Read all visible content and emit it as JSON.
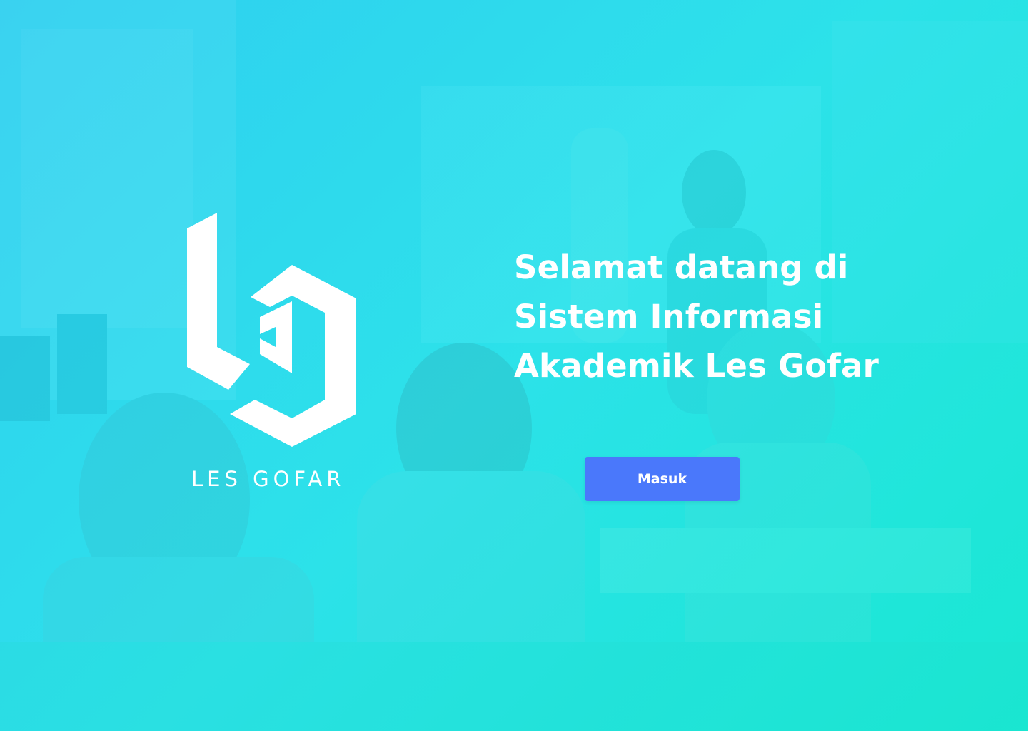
{
  "brand": {
    "name": "LES GOFAR",
    "logo_icon": "les-gofar-logo-icon"
  },
  "hero": {
    "welcome_text": "Selamat datang di Sistem Informasi Akademik Les Gofar",
    "background_image": "classroom-students-raising-hands",
    "login_label": "Masuk"
  },
  "colors": {
    "overlay_start": "#2fd0ef",
    "overlay_end": "#1ce8d2",
    "button_bg": "#4a78fb",
    "text": "#ffffff"
  }
}
